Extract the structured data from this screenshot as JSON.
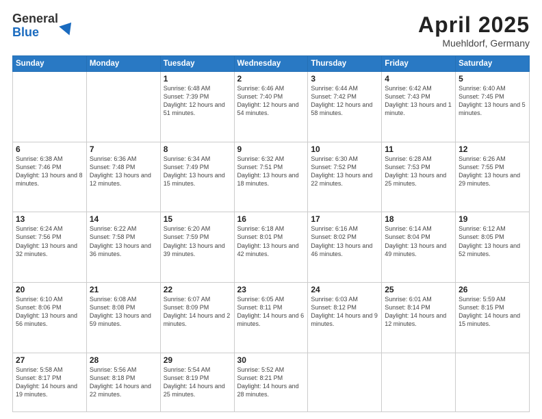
{
  "header": {
    "logo_general": "General",
    "logo_blue": "Blue",
    "title": "April 2025",
    "location": "Muehldorf, Germany"
  },
  "weekdays": [
    "Sunday",
    "Monday",
    "Tuesday",
    "Wednesday",
    "Thursday",
    "Friday",
    "Saturday"
  ],
  "weeks": [
    [
      {
        "day": "",
        "info": ""
      },
      {
        "day": "",
        "info": ""
      },
      {
        "day": "1",
        "info": "Sunrise: 6:48 AM\nSunset: 7:39 PM\nDaylight: 12 hours and 51 minutes."
      },
      {
        "day": "2",
        "info": "Sunrise: 6:46 AM\nSunset: 7:40 PM\nDaylight: 12 hours and 54 minutes."
      },
      {
        "day": "3",
        "info": "Sunrise: 6:44 AM\nSunset: 7:42 PM\nDaylight: 12 hours and 58 minutes."
      },
      {
        "day": "4",
        "info": "Sunrise: 6:42 AM\nSunset: 7:43 PM\nDaylight: 13 hours and 1 minute."
      },
      {
        "day": "5",
        "info": "Sunrise: 6:40 AM\nSunset: 7:45 PM\nDaylight: 13 hours and 5 minutes."
      }
    ],
    [
      {
        "day": "6",
        "info": "Sunrise: 6:38 AM\nSunset: 7:46 PM\nDaylight: 13 hours and 8 minutes."
      },
      {
        "day": "7",
        "info": "Sunrise: 6:36 AM\nSunset: 7:48 PM\nDaylight: 13 hours and 12 minutes."
      },
      {
        "day": "8",
        "info": "Sunrise: 6:34 AM\nSunset: 7:49 PM\nDaylight: 13 hours and 15 minutes."
      },
      {
        "day": "9",
        "info": "Sunrise: 6:32 AM\nSunset: 7:51 PM\nDaylight: 13 hours and 18 minutes."
      },
      {
        "day": "10",
        "info": "Sunrise: 6:30 AM\nSunset: 7:52 PM\nDaylight: 13 hours and 22 minutes."
      },
      {
        "day": "11",
        "info": "Sunrise: 6:28 AM\nSunset: 7:53 PM\nDaylight: 13 hours and 25 minutes."
      },
      {
        "day": "12",
        "info": "Sunrise: 6:26 AM\nSunset: 7:55 PM\nDaylight: 13 hours and 29 minutes."
      }
    ],
    [
      {
        "day": "13",
        "info": "Sunrise: 6:24 AM\nSunset: 7:56 PM\nDaylight: 13 hours and 32 minutes."
      },
      {
        "day": "14",
        "info": "Sunrise: 6:22 AM\nSunset: 7:58 PM\nDaylight: 13 hours and 36 minutes."
      },
      {
        "day": "15",
        "info": "Sunrise: 6:20 AM\nSunset: 7:59 PM\nDaylight: 13 hours and 39 minutes."
      },
      {
        "day": "16",
        "info": "Sunrise: 6:18 AM\nSunset: 8:01 PM\nDaylight: 13 hours and 42 minutes."
      },
      {
        "day": "17",
        "info": "Sunrise: 6:16 AM\nSunset: 8:02 PM\nDaylight: 13 hours and 46 minutes."
      },
      {
        "day": "18",
        "info": "Sunrise: 6:14 AM\nSunset: 8:04 PM\nDaylight: 13 hours and 49 minutes."
      },
      {
        "day": "19",
        "info": "Sunrise: 6:12 AM\nSunset: 8:05 PM\nDaylight: 13 hours and 52 minutes."
      }
    ],
    [
      {
        "day": "20",
        "info": "Sunrise: 6:10 AM\nSunset: 8:06 PM\nDaylight: 13 hours and 56 minutes."
      },
      {
        "day": "21",
        "info": "Sunrise: 6:08 AM\nSunset: 8:08 PM\nDaylight: 13 hours and 59 minutes."
      },
      {
        "day": "22",
        "info": "Sunrise: 6:07 AM\nSunset: 8:09 PM\nDaylight: 14 hours and 2 minutes."
      },
      {
        "day": "23",
        "info": "Sunrise: 6:05 AM\nSunset: 8:11 PM\nDaylight: 14 hours and 6 minutes."
      },
      {
        "day": "24",
        "info": "Sunrise: 6:03 AM\nSunset: 8:12 PM\nDaylight: 14 hours and 9 minutes."
      },
      {
        "day": "25",
        "info": "Sunrise: 6:01 AM\nSunset: 8:14 PM\nDaylight: 14 hours and 12 minutes."
      },
      {
        "day": "26",
        "info": "Sunrise: 5:59 AM\nSunset: 8:15 PM\nDaylight: 14 hours and 15 minutes."
      }
    ],
    [
      {
        "day": "27",
        "info": "Sunrise: 5:58 AM\nSunset: 8:17 PM\nDaylight: 14 hours and 19 minutes."
      },
      {
        "day": "28",
        "info": "Sunrise: 5:56 AM\nSunset: 8:18 PM\nDaylight: 14 hours and 22 minutes."
      },
      {
        "day": "29",
        "info": "Sunrise: 5:54 AM\nSunset: 8:19 PM\nDaylight: 14 hours and 25 minutes."
      },
      {
        "day": "30",
        "info": "Sunrise: 5:52 AM\nSunset: 8:21 PM\nDaylight: 14 hours and 28 minutes."
      },
      {
        "day": "",
        "info": ""
      },
      {
        "day": "",
        "info": ""
      },
      {
        "day": "",
        "info": ""
      }
    ]
  ]
}
